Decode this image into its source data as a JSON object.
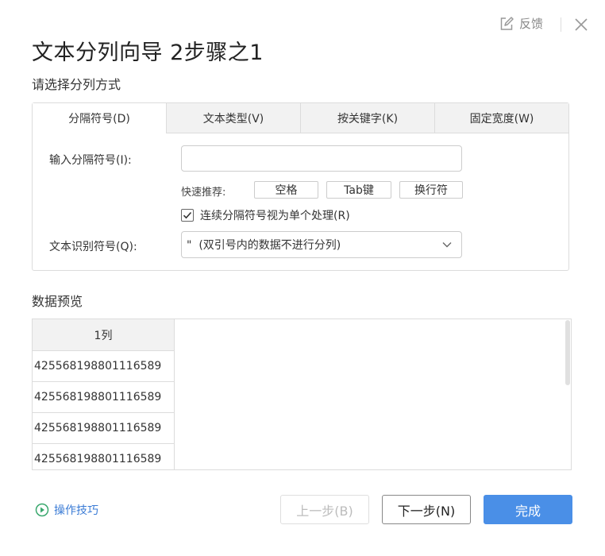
{
  "header": {
    "feedback_label": "反馈",
    "icons": {
      "feedback": "edit-icon",
      "close": "close-icon"
    }
  },
  "dialog": {
    "title": "文本分列向导 2步骤之1",
    "subtitle": "请选择分列方式"
  },
  "tabs": [
    {
      "label": "分隔符号(D)",
      "active": true
    },
    {
      "label": "文本类型(V)",
      "active": false
    },
    {
      "label": "按关键字(K)",
      "active": false
    },
    {
      "label": "固定宽度(W)",
      "active": false
    }
  ],
  "delimiter_form": {
    "input_label": "输入分隔符号(I):",
    "input_value": "",
    "quick_label": "快速推荐:",
    "quick_options": [
      "空格",
      "Tab键",
      "换行符"
    ],
    "consecutive_checkbox": {
      "label": "连续分隔符号视为单个处理(R)",
      "checked": true
    },
    "qualifier_label": "文本识别符号(Q):",
    "qualifier_value": "\"  (双引号内的数据不进行分列)"
  },
  "preview": {
    "title": "数据预览",
    "column_header": "1列",
    "rows": [
      "425568198801116589",
      "425568198801116589",
      "425568198801116589",
      "425568198801116589"
    ]
  },
  "footer": {
    "tips_label": "操作技巧",
    "prev_label": "上一步(B)",
    "next_label": "下一步(N)",
    "finish_label": "完成"
  },
  "colors": {
    "accent": "#4a8fe7",
    "link": "#3a7bd5",
    "tab_bg": "#f2f2f2",
    "border": "#dcdcdc"
  }
}
